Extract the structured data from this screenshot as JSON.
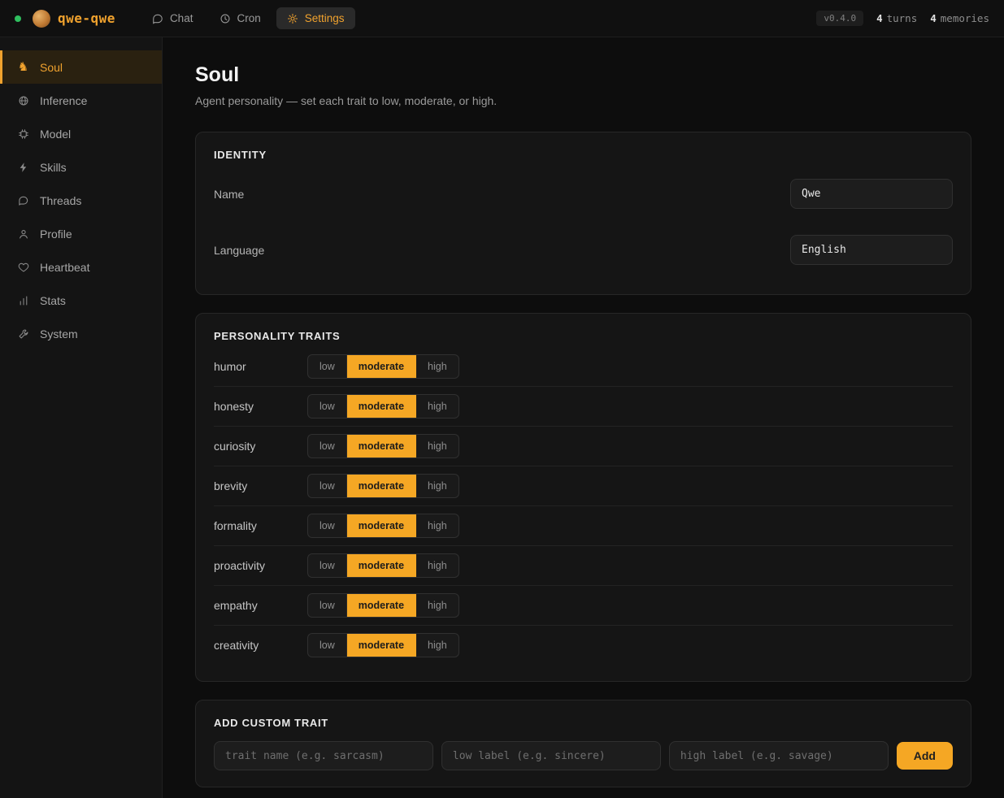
{
  "topbar": {
    "app_name": "qwe-qwe",
    "nav": [
      {
        "label": "Chat",
        "icon": "chat-bubble",
        "active": false
      },
      {
        "label": "Cron",
        "icon": "clock",
        "active": false
      },
      {
        "label": "Settings",
        "icon": "gear",
        "active": true
      }
    ],
    "version": "v0.4.0",
    "stats": [
      {
        "count": "4",
        "label": "turns"
      },
      {
        "count": "4",
        "label": "memories"
      }
    ]
  },
  "sidebar": {
    "items": [
      {
        "label": "Soul",
        "icon": "knight",
        "active": true
      },
      {
        "label": "Inference",
        "icon": "globe",
        "active": false
      },
      {
        "label": "Model",
        "icon": "chip",
        "active": false
      },
      {
        "label": "Skills",
        "icon": "lightning",
        "active": false
      },
      {
        "label": "Threads",
        "icon": "speech-bubble",
        "active": false
      },
      {
        "label": "Profile",
        "icon": "person",
        "active": false
      },
      {
        "label": "Heartbeat",
        "icon": "heart",
        "active": false
      },
      {
        "label": "Stats",
        "icon": "bar-chart",
        "active": false
      },
      {
        "label": "System",
        "icon": "wrench",
        "active": false
      }
    ]
  },
  "page": {
    "title": "Soul",
    "subtitle": "Agent personality — set each trait to low, moderate, or high."
  },
  "identity": {
    "header": "IDENTITY",
    "fields": [
      {
        "label": "Name",
        "value": "Qwe"
      },
      {
        "label": "Language",
        "value": "English"
      }
    ]
  },
  "traits": {
    "header": "PERSONALITY TRAITS",
    "options": [
      "low",
      "moderate",
      "high"
    ],
    "items": [
      {
        "name": "humor",
        "selected": "moderate"
      },
      {
        "name": "honesty",
        "selected": "moderate"
      },
      {
        "name": "curiosity",
        "selected": "moderate"
      },
      {
        "name": "brevity",
        "selected": "moderate"
      },
      {
        "name": "formality",
        "selected": "moderate"
      },
      {
        "name": "proactivity",
        "selected": "moderate"
      },
      {
        "name": "empathy",
        "selected": "moderate"
      },
      {
        "name": "creativity",
        "selected": "moderate"
      }
    ]
  },
  "custom_trait": {
    "header": "ADD CUSTOM TRAIT",
    "inputs": [
      {
        "placeholder": "trait name (e.g. sarcasm)"
      },
      {
        "placeholder": "low label (e.g. sincere)"
      },
      {
        "placeholder": "high label (e.g. savage)"
      }
    ],
    "add_label": "Add"
  },
  "colors": {
    "accent": "#f5a724",
    "status_dot": "#2fbf5f"
  }
}
